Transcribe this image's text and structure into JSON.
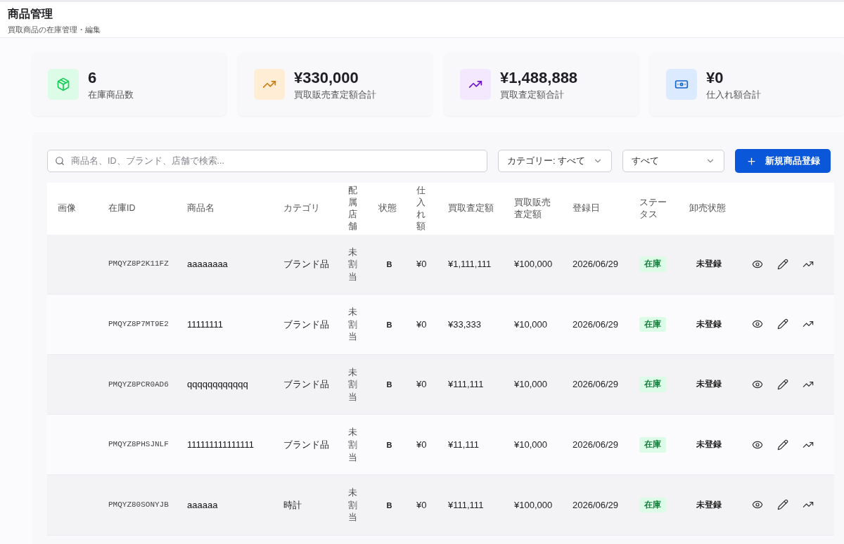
{
  "header": {
    "title": "商品管理",
    "subtitle": "買取商品の在庫管理・編集"
  },
  "stats": [
    {
      "kind": "stock",
      "color": "#dcfce7",
      "value": "6",
      "label": "在庫商品数"
    },
    {
      "kind": "trend",
      "color": "#ffedd5",
      "value": "¥330,000",
      "label": "買取販売査定額合計"
    },
    {
      "kind": "trend",
      "color": "#f3e8ff",
      "value": "¥1,488,888",
      "label": "買取査定額合計"
    },
    {
      "kind": "money",
      "color": "#dbeafe",
      "value": "¥0",
      "label": "仕入れ額合計"
    }
  ],
  "toolbar": {
    "search": {
      "placeholder": "商品名、ID、ブランド、店舗で検索..."
    },
    "filters": [
      {
        "value": "カテゴリー: すべて"
      },
      {
        "value": "すべて"
      }
    ],
    "new_button": {
      "label": "新規商品登録"
    }
  },
  "table": {
    "columns": [
      "画像",
      "在庫ID",
      "商品名",
      "カテゴリ",
      "配属店舗",
      "状態",
      "仕入れ額",
      "買取査定額",
      "買取販売査定額",
      "登録日",
      "ステータス",
      "卸売状態"
    ],
    "rows": [
      {
        "id": "PMQYZ8P2K11FZ",
        "name": "aaaaaaaa",
        "category": "ブランド品",
        "store": "未割当",
        "condition": "B",
        "cost": "¥0",
        "buy_price": "¥1,111,111",
        "sale_price": "¥100,000",
        "date": "2026/06/29",
        "status": "在庫",
        "wholesale": "未登録"
      },
      {
        "id": "PMQYZ8P7MT9E2",
        "name": "11111111",
        "category": "ブランド品",
        "store": "未割当",
        "condition": "B",
        "cost": "¥0",
        "buy_price": "¥33,333",
        "sale_price": "¥10,000",
        "date": "2026/06/29",
        "status": "在庫",
        "wholesale": "未登録"
      },
      {
        "id": "PMQYZ8PCR0AD6",
        "name": "qqqqqqqqqqqq",
        "category": "ブランド品",
        "store": "未割当",
        "condition": "B",
        "cost": "¥0",
        "buy_price": "¥111,111",
        "sale_price": "¥10,000",
        "date": "2026/06/29",
        "status": "在庫",
        "wholesale": "未登録"
      },
      {
        "id": "PMQYZ8PHSJNLF",
        "name": "111111111111111",
        "category": "ブランド品",
        "store": "未割当",
        "condition": "B",
        "cost": "¥0",
        "buy_price": "¥11,111",
        "sale_price": "¥10,000",
        "date": "2026/06/29",
        "status": "在庫",
        "wholesale": "未登録"
      },
      {
        "id": "PMQYZ80SONYJB",
        "name": "aaaaaa",
        "category": "時計",
        "store": "未割当",
        "condition": "B",
        "cost": "¥0",
        "buy_price": "¥111,111",
        "sale_price": "¥100,000",
        "date": "2026/06/29",
        "status": "在庫",
        "wholesale": "未登録"
      }
    ]
  }
}
